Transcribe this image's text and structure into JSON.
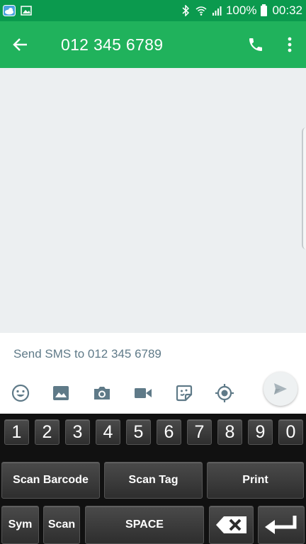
{
  "status_bar": {
    "battery_percent": "100%",
    "time": "00:32",
    "signal_label": "all"
  },
  "header": {
    "title": "012 345 6789"
  },
  "compose": {
    "placeholder": "Send SMS to 012 345 6789"
  },
  "keyboard": {
    "numbers": [
      "1",
      "2",
      "3",
      "4",
      "5",
      "6",
      "7",
      "8",
      "9",
      "0"
    ],
    "scan_barcode": "Scan Barcode",
    "scan_tag": "Scan Tag",
    "print": "Print",
    "sym": "Sym",
    "scan": "Scan",
    "space": "SPACE"
  },
  "colors": {
    "status_bar": "#0b9a4e",
    "app_bar": "#20b25c",
    "conversation_bg": "#eceff1",
    "icon_gray": "#5f7a88"
  },
  "icons": {
    "back": "arrow-left-icon",
    "call": "phone-icon",
    "more": "more-vert-icon",
    "emoji": "emoji-icon",
    "gallery": "image-icon",
    "camera": "camera-icon",
    "video": "video-icon",
    "sticker": "sticker-icon",
    "location": "location-icon",
    "send": "send-icon"
  }
}
